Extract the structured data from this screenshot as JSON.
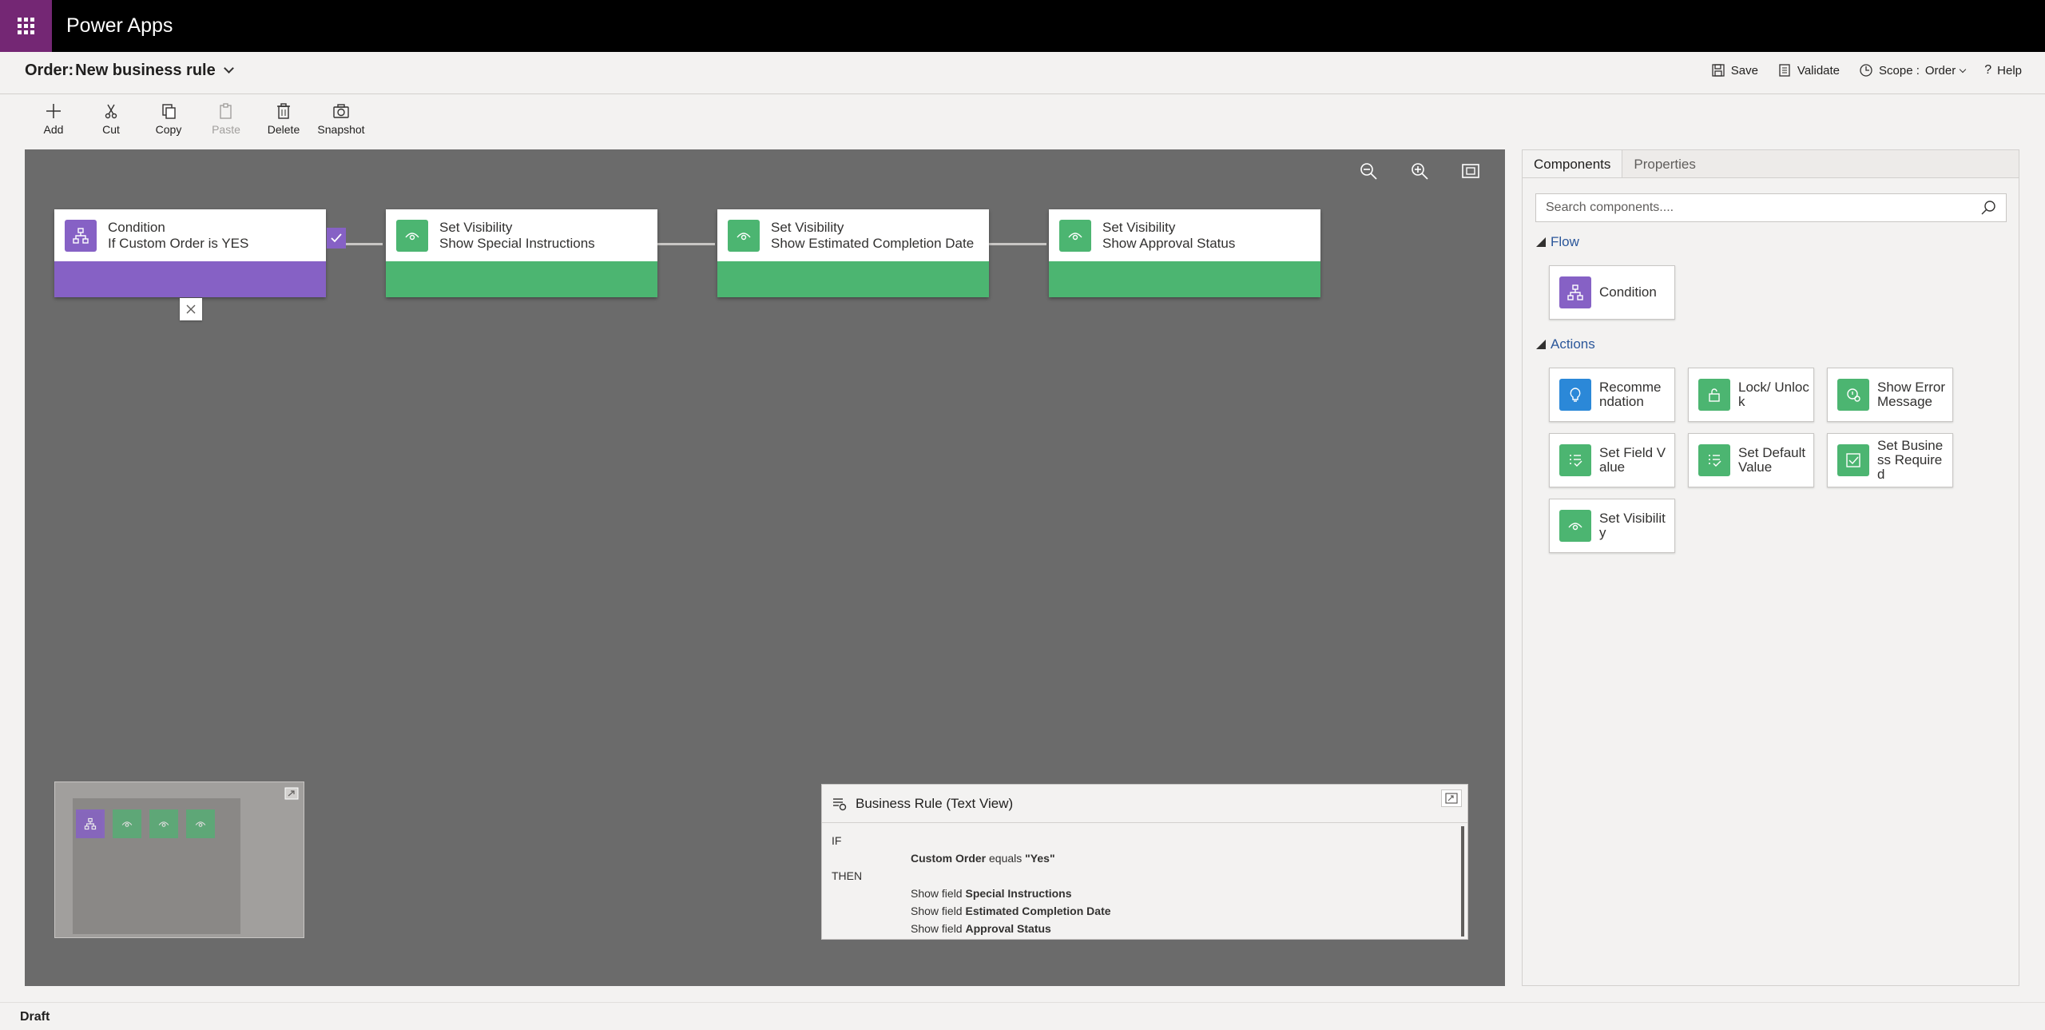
{
  "app": {
    "name": "Power Apps"
  },
  "header": {
    "entity": "Order:",
    "rule_name": "New business rule",
    "save": "Save",
    "validate": "Validate",
    "scope_label": "Scope :",
    "scope_value": "Order",
    "help": "Help"
  },
  "commands": [
    {
      "label": "Add",
      "icon": "add-icon",
      "enabled": true
    },
    {
      "label": "Cut",
      "icon": "cut-icon",
      "enabled": true
    },
    {
      "label": "Copy",
      "icon": "copy-icon",
      "enabled": true
    },
    {
      "label": "Paste",
      "icon": "paste-icon",
      "enabled": false
    },
    {
      "label": "Delete",
      "icon": "delete-icon",
      "enabled": true
    },
    {
      "label": "Snapshot",
      "icon": "camera-icon",
      "enabled": true
    }
  ],
  "canvas": {
    "nodes": [
      {
        "type": "condition",
        "title": "Condition",
        "subtitle": "If Custom Order is YES",
        "icon": "condition-icon"
      },
      {
        "type": "action",
        "title": "Set Visibility",
        "subtitle": "Show Special Instructions",
        "icon": "eye-icon"
      },
      {
        "type": "action",
        "title": "Set Visibility",
        "subtitle": "Show Estimated Completion Date",
        "icon": "eye-icon"
      },
      {
        "type": "action",
        "title": "Set Visibility",
        "subtitle": "Show Approval Status",
        "icon": "eye-icon"
      }
    ]
  },
  "text_view": {
    "title": "Business Rule (Text View)",
    "if_label": "IF",
    "then_label": "THEN",
    "condition": {
      "field": "Custom Order",
      "operator": "equals",
      "value": "\"Yes\""
    },
    "actions": [
      {
        "prefix": "Show field",
        "field": "Special Instructions"
      },
      {
        "prefix": "Show field",
        "field": "Estimated Completion Date"
      },
      {
        "prefix": "Show field",
        "field": "Approval Status"
      }
    ]
  },
  "panel": {
    "tabs": [
      "Components",
      "Properties"
    ],
    "search_placeholder": "Search components....",
    "flow_title": "Flow",
    "actions_title": "Actions",
    "flow_items": [
      {
        "label": "Condition",
        "icon": "condition-icon"
      }
    ],
    "action_items": [
      {
        "label": "Recomme ndation",
        "icon": "lightbulb-icon"
      },
      {
        "label": "Lock/ Unlock",
        "icon": "lock-icon"
      },
      {
        "label": "Show Error Message",
        "icon": "error-message-icon"
      },
      {
        "label": "Set Field Value",
        "icon": "field-value-icon"
      },
      {
        "label": "Set Default Value",
        "icon": "default-value-icon"
      },
      {
        "label": "Set Business Required",
        "icon": "required-icon"
      },
      {
        "label": "Set Visibility",
        "icon": "eye-icon"
      }
    ]
  },
  "status": {
    "text": "Draft"
  },
  "colors": {
    "brand": "#742774",
    "condition": "#8661c5",
    "action": "#4cb571",
    "recommendation": "#2b88d8",
    "canvas": "#6b6b6b"
  }
}
